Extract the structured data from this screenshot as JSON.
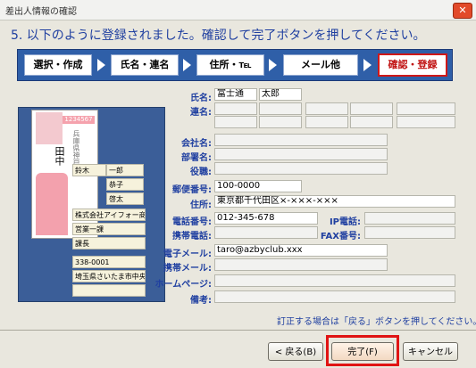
{
  "window": {
    "title": "差出人情報の確認"
  },
  "instruction": "5. 以下のように登録されました。確認して完了ボタンを押してください。",
  "steps": [
    {
      "label": "選択・作成"
    },
    {
      "label": "氏名・連名"
    },
    {
      "label": "住所・℡"
    },
    {
      "label": "メール他"
    },
    {
      "label": "確認・登録"
    }
  ],
  "preview": {
    "card_zip": "1234567",
    "card_addr": "兵庫県神戸市",
    "card_name": "田中",
    "fields": [
      "鈴木",
      "一郎",
      "恭子",
      "啓太",
      "株式会社アイフォー商事",
      "営業一課",
      "課長",
      "338-0001",
      "埼玉県さいたま市中央区"
    ]
  },
  "form": {
    "name_label": "氏名:",
    "sei": "富士通",
    "mei": "太郎",
    "renmei_label": "連名:",
    "company_label": "会社名:",
    "department_label": "部署名:",
    "position_label": "役職:",
    "zip_label": "郵便番号:",
    "zip": "100-0000",
    "address_label": "住所:",
    "address": "東京都千代田区×-×××-×××",
    "phone_label": "電話番号:",
    "phone": "012-345-678",
    "ip_phone_label": "IP電話:",
    "mobile_label": "携帯電話:",
    "fax_label": "FAX番号:",
    "email_label": "電子メール:",
    "email": "taro@azbyclub.xxx",
    "mobile_mail_label": "携帯メール:",
    "homepage_label": "ホームページ:",
    "memo_label": "備考:"
  },
  "note": "訂正する場合は「戻る」ボタンを押してください。",
  "buttons": {
    "back": "< 戻る(B)",
    "finish": "完了(F)",
    "cancel": "キャンセル"
  },
  "colors": {
    "accent": "#1f3fa0",
    "step_bar": "#2f5fa8",
    "highlight": "#e01414"
  }
}
